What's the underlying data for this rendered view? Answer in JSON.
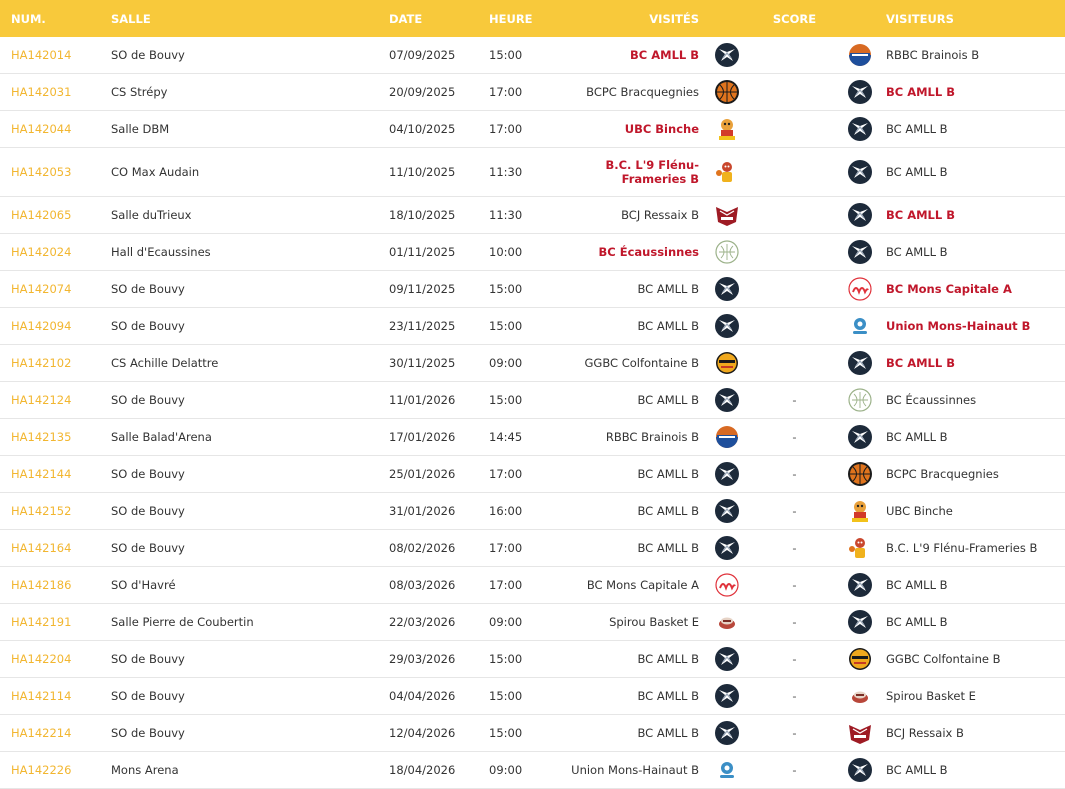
{
  "headers": {
    "num": "NUM.",
    "salle": "SALLE",
    "date": "DATE",
    "heure": "HEURE",
    "visites": "VISITÉS",
    "score": "SCORE",
    "visiteurs": "VISITEURS"
  },
  "colors": {
    "header_bg": "#f8c93b",
    "num_link": "#f2b630",
    "winner": "#c0172b"
  },
  "rows": [
    {
      "num": "HA142014",
      "salle": "SO de Bouvy",
      "date": "07/09/2025",
      "heure": "15:00",
      "home": "BC AMLL B",
      "home_logo": "amll-logo",
      "home_win": true,
      "score": "",
      "away": "RBBC Brainois B",
      "away_logo": "rbbc-logo",
      "away_win": false
    },
    {
      "num": "HA142031",
      "salle": "CS Strépy",
      "date": "20/09/2025",
      "heure": "17:00",
      "home": "BCPC Bracquegnies",
      "home_logo": "bcpc-logo",
      "home_win": false,
      "score": "",
      "away": "BC AMLL B",
      "away_logo": "amll-logo",
      "away_win": true
    },
    {
      "num": "HA142044",
      "salle": "Salle DBM",
      "date": "04/10/2025",
      "heure": "17:00",
      "home": "UBC Binche",
      "home_logo": "ubc-logo",
      "home_win": true,
      "score": "",
      "away": "BC AMLL B",
      "away_logo": "amll-logo",
      "away_win": false
    },
    {
      "num": "HA142053",
      "salle": "CO Max Audain",
      "date": "11/10/2025",
      "heure": "11:30",
      "home": "B.C. L'9 Flénu-Frameries B",
      "home_logo": "flenu-logo",
      "home_win": true,
      "score": "",
      "away": "BC AMLL B",
      "away_logo": "amll-logo",
      "away_win": false
    },
    {
      "num": "HA142065",
      "salle": "Salle duTrieux",
      "date": "18/10/2025",
      "heure": "11:30",
      "home": "BCJ Ressaix B",
      "home_logo": "ressaix-logo",
      "home_win": false,
      "score": "",
      "away": "BC AMLL B",
      "away_logo": "amll-logo",
      "away_win": true
    },
    {
      "num": "HA142024",
      "salle": "Hall d'Ecaussines",
      "date": "01/11/2025",
      "heure": "10:00",
      "home": "BC Écaussinnes",
      "home_logo": "ecaussinnes-logo",
      "home_win": true,
      "score": "",
      "away": "BC AMLL B",
      "away_logo": "amll-logo",
      "away_win": false
    },
    {
      "num": "HA142074",
      "salle": "SO de Bouvy",
      "date": "09/11/2025",
      "heure": "15:00",
      "home": "BC AMLL B",
      "home_logo": "amll-logo",
      "home_win": false,
      "score": "",
      "away": "BC Mons Capitale A",
      "away_logo": "mons-logo",
      "away_win": true
    },
    {
      "num": "HA142094",
      "salle": "SO de Bouvy",
      "date": "23/11/2025",
      "heure": "15:00",
      "home": "BC AMLL B",
      "home_logo": "amll-logo",
      "home_win": false,
      "score": "",
      "away": "Union Mons-Hainaut B",
      "away_logo": "union-logo",
      "away_win": true
    },
    {
      "num": "HA142102",
      "salle": "CS Achille Delattre",
      "date": "30/11/2025",
      "heure": "09:00",
      "home": "GGBC Colfontaine B",
      "home_logo": "ggbc-logo",
      "home_win": false,
      "score": "",
      "away": "BC AMLL B",
      "away_logo": "amll-logo",
      "away_win": true
    },
    {
      "num": "HA142124",
      "salle": "SO de Bouvy",
      "date": "11/01/2026",
      "heure": "15:00",
      "home": "BC AMLL B",
      "home_logo": "amll-logo",
      "home_win": false,
      "score": "-",
      "away": "BC Écaussinnes",
      "away_logo": "ecaussinnes-logo",
      "away_win": false
    },
    {
      "num": "HA142135",
      "salle": "Salle Balad'Arena",
      "date": "17/01/2026",
      "heure": "14:45",
      "home": "RBBC Brainois B",
      "home_logo": "rbbc-logo",
      "home_win": false,
      "score": "-",
      "away": "BC AMLL B",
      "away_logo": "amll-logo",
      "away_win": false
    },
    {
      "num": "HA142144",
      "salle": "SO de Bouvy",
      "date": "25/01/2026",
      "heure": "17:00",
      "home": "BC AMLL B",
      "home_logo": "amll-logo",
      "home_win": false,
      "score": "-",
      "away": "BCPC Bracquegnies",
      "away_logo": "bcpc-logo",
      "away_win": false
    },
    {
      "num": "HA142152",
      "salle": "SO de Bouvy",
      "date": "31/01/2026",
      "heure": "16:00",
      "home": "BC AMLL B",
      "home_logo": "amll-logo",
      "home_win": false,
      "score": "-",
      "away": "UBC Binche",
      "away_logo": "ubc-logo",
      "away_win": false
    },
    {
      "num": "HA142164",
      "salle": "SO de Bouvy",
      "date": "08/02/2026",
      "heure": "17:00",
      "home": "BC AMLL B",
      "home_logo": "amll-logo",
      "home_win": false,
      "score": "-",
      "away": "B.C. L'9 Flénu-Frameries B",
      "away_logo": "flenu-logo",
      "away_win": false
    },
    {
      "num": "HA142186",
      "salle": "SO d'Havré",
      "date": "08/03/2026",
      "heure": "17:00",
      "home": "BC Mons Capitale A",
      "home_logo": "mons-logo",
      "home_win": false,
      "score": "-",
      "away": "BC AMLL B",
      "away_logo": "amll-logo",
      "away_win": false
    },
    {
      "num": "HA142191",
      "salle": "Salle Pierre de Coubertin",
      "date": "22/03/2026",
      "heure": "09:00",
      "home": "Spirou Basket E",
      "home_logo": "spirou-logo",
      "home_win": false,
      "score": "-",
      "away": "BC AMLL B",
      "away_logo": "amll-logo",
      "away_win": false
    },
    {
      "num": "HA142204",
      "salle": "SO de Bouvy",
      "date": "29/03/2026",
      "heure": "15:00",
      "home": "BC AMLL B",
      "home_logo": "amll-logo",
      "home_win": false,
      "score": "-",
      "away": "GGBC Colfontaine B",
      "away_logo": "ggbc-logo",
      "away_win": false
    },
    {
      "num": "HA142114",
      "salle": "SO de Bouvy",
      "date": "04/04/2026",
      "heure": "15:00",
      "home": "BC AMLL B",
      "home_logo": "amll-logo",
      "home_win": false,
      "score": "-",
      "away": "Spirou Basket E",
      "away_logo": "spirou-logo",
      "away_win": false
    },
    {
      "num": "HA142214",
      "salle": "SO de Bouvy",
      "date": "12/04/2026",
      "heure": "15:00",
      "home": "BC AMLL B",
      "home_logo": "amll-logo",
      "home_win": false,
      "score": "-",
      "away": "BCJ Ressaix B",
      "away_logo": "ressaix-logo",
      "away_win": false
    },
    {
      "num": "HA142226",
      "salle": "Mons Arena",
      "date": "18/04/2026",
      "heure": "09:00",
      "home": "Union Mons-Hainaut B",
      "home_logo": "union-logo",
      "home_win": false,
      "score": "-",
      "away": "BC AMLL B",
      "away_logo": "amll-logo",
      "away_win": false
    }
  ]
}
